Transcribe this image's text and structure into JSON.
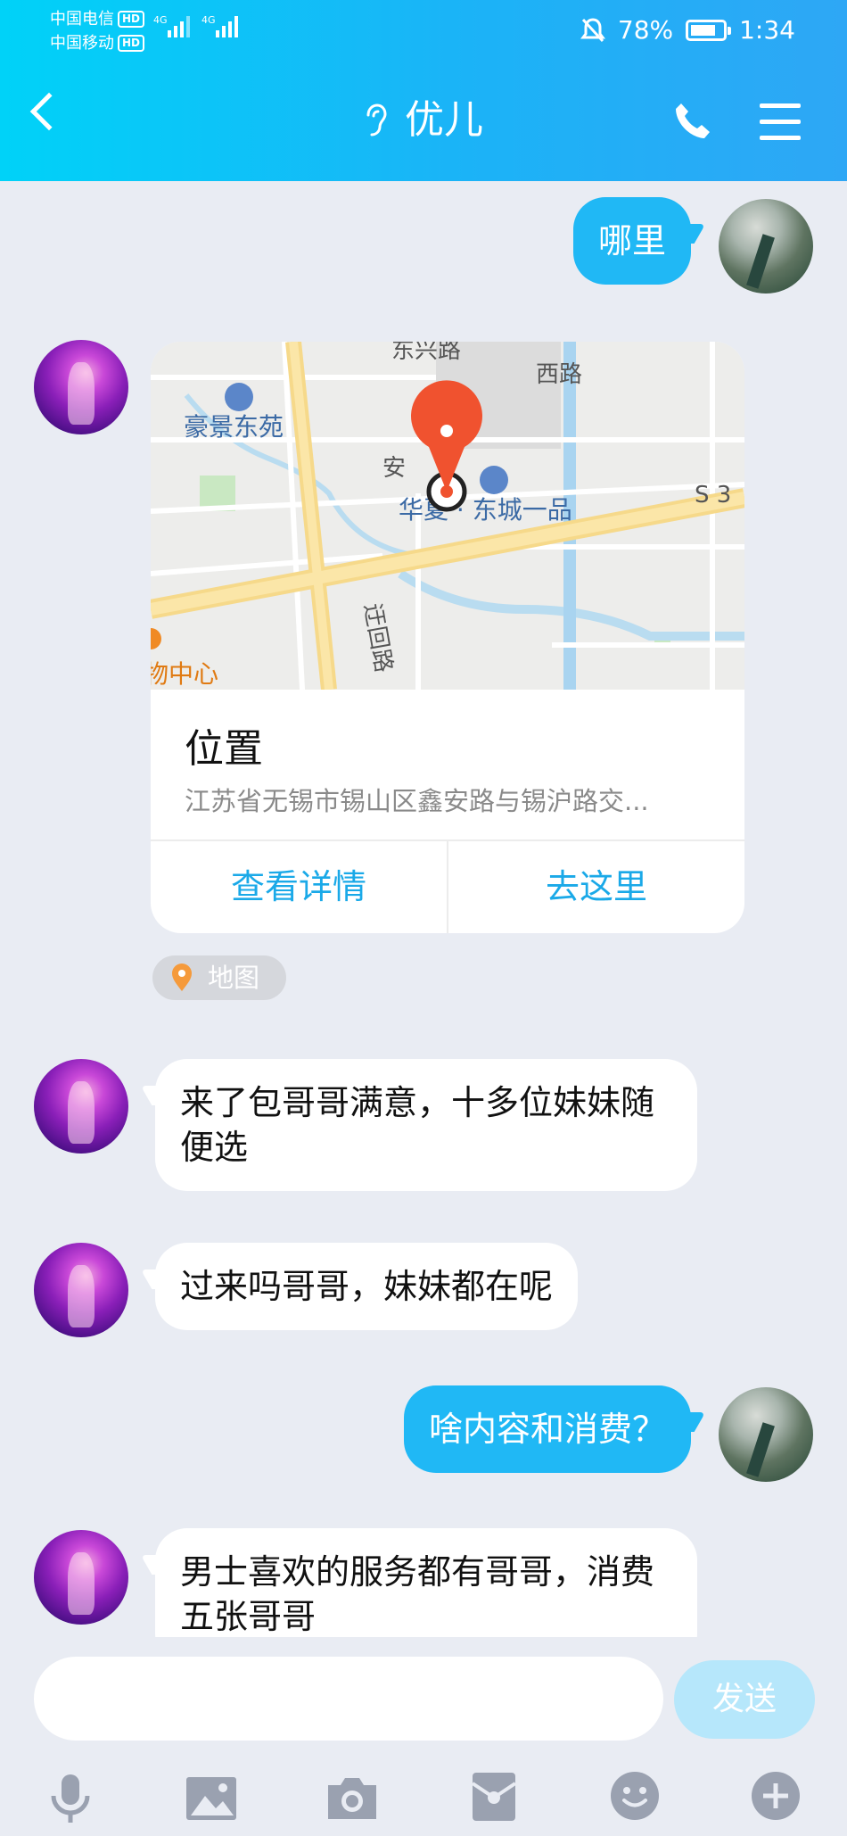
{
  "status_bar": {
    "carrier1": "中国电信",
    "carrier2": "中国移动",
    "hd": "HD",
    "net1": "4G",
    "net2": "4G",
    "battery": "78%",
    "time": "1:34"
  },
  "header": {
    "title": "优儿"
  },
  "messages": [
    {
      "from": "me",
      "text": "哪里"
    },
    {
      "from": "her",
      "type": "location",
      "map_labels": {
        "road1": "东兴路",
        "road2": "西路",
        "place1": "豪景东苑",
        "road3": "安",
        "place2": "华夏 · 东城一品",
        "road4": "S 3",
        "road5": "迂回路",
        "place3": "物中心"
      },
      "title": "位置",
      "address": "江苏省无锡市锡山区鑫安路与锡沪路交...",
      "action_detail": "查看详情",
      "action_go": "去这里",
      "tag": "地图"
    },
    {
      "from": "her",
      "text": "来了包哥哥满意，十多位妹妹随便选"
    },
    {
      "from": "her",
      "text": "过来吗哥哥，妹妹都在呢"
    },
    {
      "from": "me",
      "text": "啥内容和消费？"
    },
    {
      "from": "her",
      "text": "男士喜欢的服务都有哥哥，消费五张哥哥"
    }
  ],
  "input": {
    "value": "",
    "send_label": "发送"
  },
  "colors": {
    "header_start": "#00d2f8",
    "header_end": "#2ea7f5",
    "bubble_me": "#20b8f5",
    "link": "#1aa9e8",
    "pin": "#f0522f"
  },
  "icons": [
    "back-icon",
    "ear-icon",
    "phone-icon",
    "menu-icon",
    "voice-icon",
    "image-icon",
    "camera-icon",
    "red-packet-icon",
    "emoji-icon",
    "plus-icon"
  ]
}
